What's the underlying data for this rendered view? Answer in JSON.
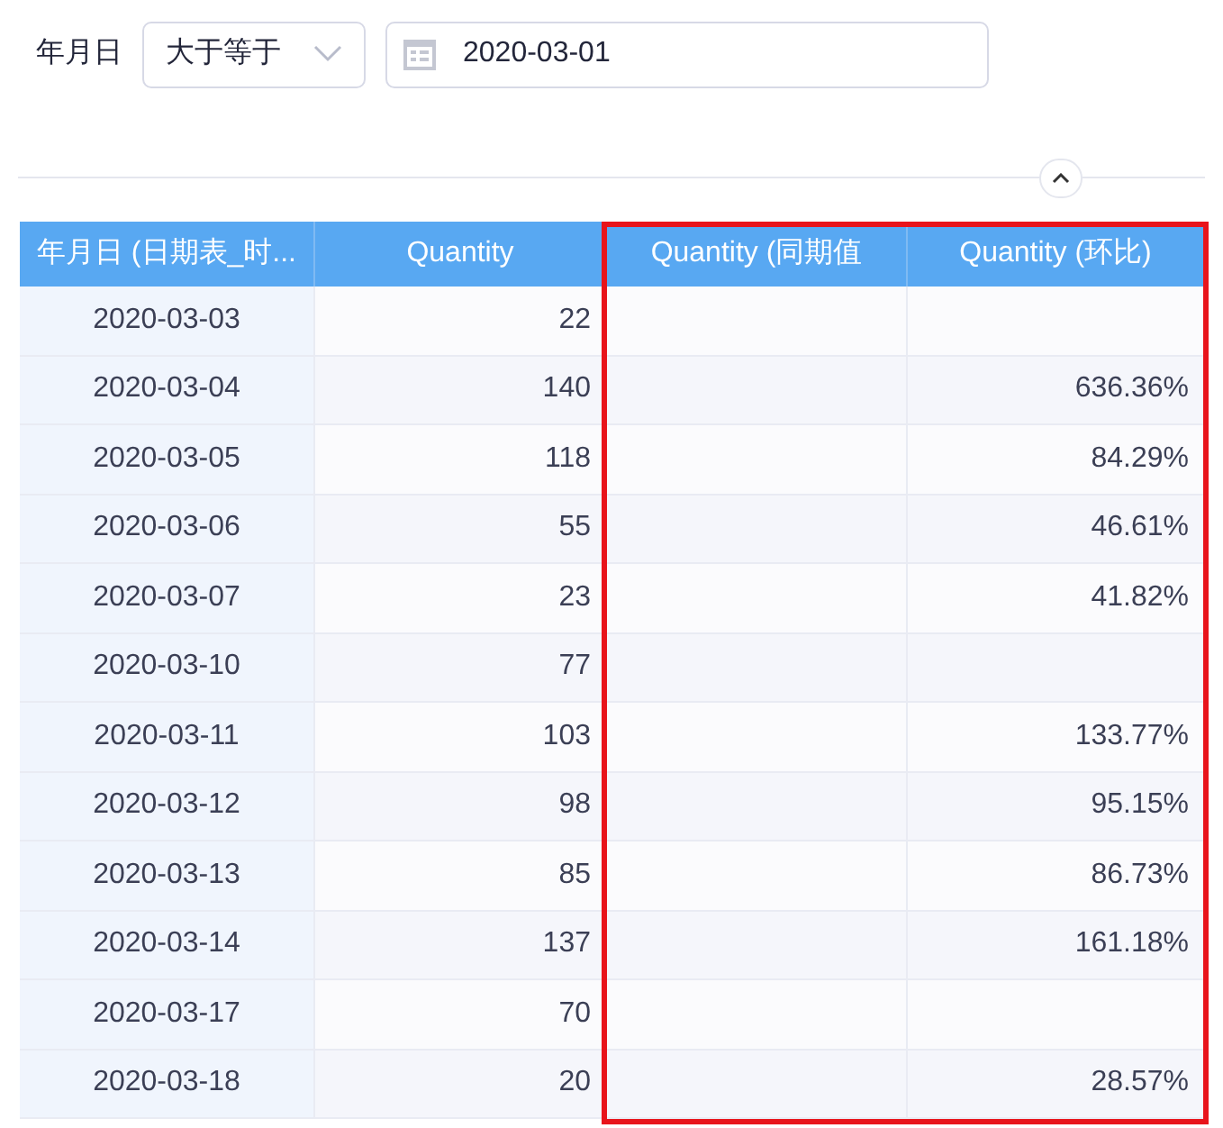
{
  "filter": {
    "label": "年月日",
    "operator": "大于等于",
    "date": "2020-03-01"
  },
  "table": {
    "columns": [
      {
        "label": "年月日 (日期表_时...",
        "highlighted": false
      },
      {
        "label": "Quantity",
        "highlighted": false
      },
      {
        "label": "Quantity (同期值",
        "highlighted": true
      },
      {
        "label": "Quantity (环比)",
        "highlighted": true
      }
    ],
    "rows": [
      [
        "2020-03-03",
        "22",
        "",
        ""
      ],
      [
        "2020-03-04",
        "140",
        "",
        "636.36%"
      ],
      [
        "2020-03-05",
        "118",
        "",
        "84.29%"
      ],
      [
        "2020-03-06",
        "55",
        "",
        "46.61%"
      ],
      [
        "2020-03-07",
        "23",
        "",
        "41.82%"
      ],
      [
        "2020-03-10",
        "77",
        "",
        ""
      ],
      [
        "2020-03-11",
        "103",
        "",
        "133.77%"
      ],
      [
        "2020-03-12",
        "98",
        "",
        "95.15%"
      ],
      [
        "2020-03-13",
        "85",
        "",
        "86.73%"
      ],
      [
        "2020-03-14",
        "137",
        "",
        "161.18%"
      ],
      [
        "2020-03-17",
        "70",
        "",
        ""
      ],
      [
        "2020-03-18",
        "20",
        "",
        "28.57%"
      ]
    ]
  }
}
